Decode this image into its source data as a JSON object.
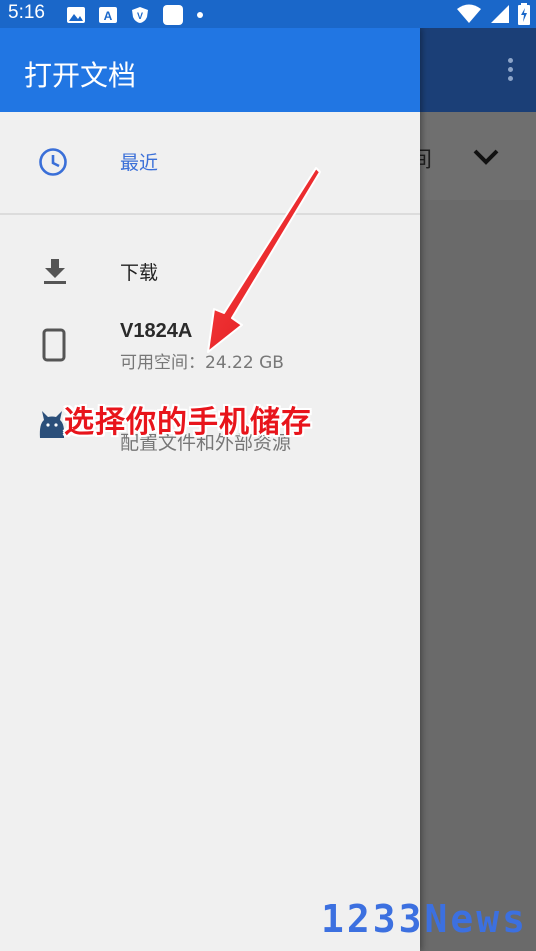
{
  "status_bar": {
    "time": "5:16"
  },
  "drawer": {
    "title": "打开文档",
    "items": [
      {
        "title": "最近",
        "icon": "clock-icon"
      },
      {
        "title": "下载",
        "icon": "download-icon"
      },
      {
        "title": "V1824A",
        "summary": "可用空间：24.22 GB",
        "icon": "phone-icon"
      },
      {
        "title": "",
        "summary": "配置文件和外部资源",
        "icon": "cat-icon"
      }
    ]
  },
  "background": {
    "partial_text": "间"
  },
  "annotation": {
    "text": "选择你的手机储存"
  },
  "watermark": "1233News",
  "colors": {
    "drawer_header": "#2176e3",
    "accent_text": "#3a6fd8",
    "annotation": "#e8141b"
  }
}
